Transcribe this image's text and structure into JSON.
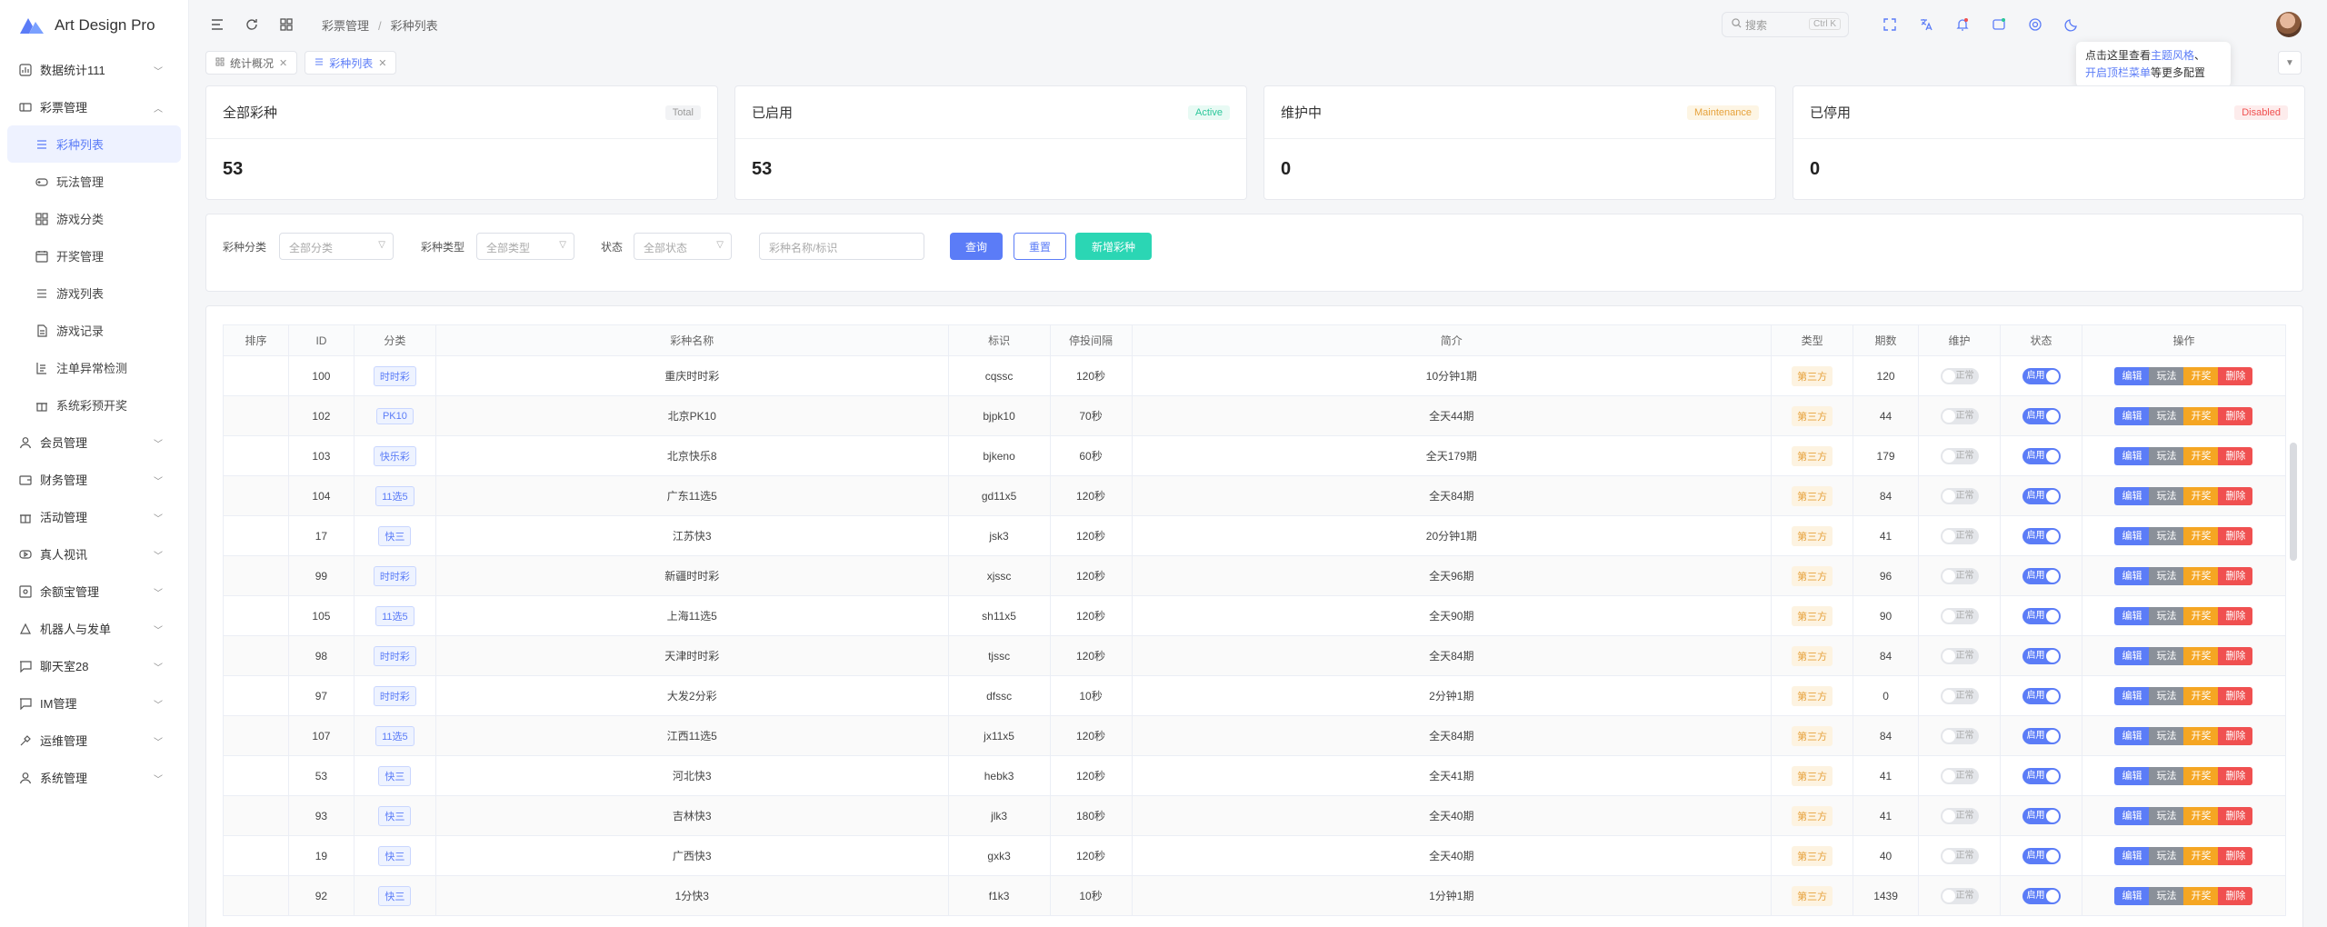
{
  "app": {
    "name": "Art Design Pro",
    "brand_color": "#5b7cf7"
  },
  "sidebar": {
    "items": [
      {
        "label": "数据统计111",
        "icon": "chart-icon",
        "expanded": false
      },
      {
        "label": "彩票管理",
        "icon": "ticket-icon",
        "expanded": true
      },
      {
        "label": "会员管理",
        "icon": "user-icon",
        "expanded": false
      },
      {
        "label": "财务管理",
        "icon": "wallet-icon",
        "expanded": false
      },
      {
        "label": "活动管理",
        "icon": "gift-icon",
        "expanded": false
      },
      {
        "label": "真人视讯",
        "icon": "video-icon",
        "expanded": false
      },
      {
        "label": "余额宝管理",
        "icon": "safe-icon",
        "expanded": false
      },
      {
        "label": "机器人与发单",
        "icon": "robot-icon",
        "expanded": false
      },
      {
        "label": "聊天室28",
        "icon": "chat-icon",
        "expanded": false
      },
      {
        "label": "IM管理",
        "icon": "message-icon",
        "expanded": false
      },
      {
        "label": "运维管理",
        "icon": "tools-icon",
        "expanded": false
      },
      {
        "label": "系统管理",
        "icon": "user-icon",
        "expanded": false
      }
    ],
    "subitems": [
      {
        "label": "彩种列表",
        "icon": "list-icon",
        "active": true
      },
      {
        "label": "玩法管理",
        "icon": "gamepad-icon",
        "active": false
      },
      {
        "label": "游戏分类",
        "icon": "grid-icon",
        "active": false
      },
      {
        "label": "开奖管理",
        "icon": "calendar-icon",
        "active": false
      },
      {
        "label": "游戏列表",
        "icon": "list-icon",
        "active": false
      },
      {
        "label": "游戏记录",
        "icon": "document-icon",
        "active": false
      },
      {
        "label": "注单异常检测",
        "icon": "scan-icon",
        "active": false
      },
      {
        "label": "系统彩预开奖",
        "icon": "gift-icon",
        "active": false
      }
    ]
  },
  "topbar": {
    "breadcrumb": [
      "彩票管理",
      "彩种列表"
    ],
    "search_placeholder": "搜索",
    "search_shortcut": "Ctrl K"
  },
  "tabs": [
    {
      "label": "统计概况",
      "active": false
    },
    {
      "label": "彩种列表",
      "active": true
    }
  ],
  "tooltip": {
    "prefix": "点击这里查看",
    "link1": "主题风格",
    "sep": "、",
    "link2": "开启顶栏菜单",
    "suffix": "等更多配置"
  },
  "stats": [
    {
      "title": "全部彩种",
      "tag": "Total",
      "value": "53",
      "tag_bg": "#f2f3f5",
      "tag_color": "#999999"
    },
    {
      "title": "已启用",
      "tag": "Active",
      "value": "53",
      "tag_bg": "#e8faf4",
      "tag_color": "#2bc79a"
    },
    {
      "title": "维护中",
      "tag": "Maintenance",
      "value": "0",
      "tag_bg": "#fdf5e4",
      "tag_color": "#e6a23c"
    },
    {
      "title": "已停用",
      "tag": "Disabled",
      "value": "0",
      "tag_bg": "#fdecec",
      "tag_color": "#f05050"
    }
  ],
  "filter": {
    "category_label": "彩种分类",
    "category_placeholder": "全部分类",
    "type_label": "彩种类型",
    "type_placeholder": "全部类型",
    "status_label": "状态",
    "status_placeholder": "全部状态",
    "keyword_placeholder": "彩种名称/标识",
    "search_btn": "查询",
    "reset_btn": "重置",
    "add_btn": "新增彩种"
  },
  "table": {
    "headers": [
      "排序",
      "ID",
      "分类",
      "彩种名称",
      "标识",
      "停投间隔",
      "简介",
      "类型",
      "期数",
      "维护",
      "状态",
      "操作"
    ],
    "maintenance_label": "正常",
    "status_label": "启用",
    "actions": [
      "编辑",
      "玩法",
      "开奖",
      "删除"
    ],
    "rows": [
      {
        "id": "100",
        "cat": "时时彩",
        "name": "重庆时时彩",
        "code": "cqssc",
        "interval": "120秒",
        "desc": "10分钟1期",
        "type": "第三方",
        "issues": "120"
      },
      {
        "id": "102",
        "cat": "PK10",
        "name": "北京PK10",
        "code": "bjpk10",
        "interval": "70秒",
        "desc": "全天44期",
        "type": "第三方",
        "issues": "44"
      },
      {
        "id": "103",
        "cat": "快乐彩",
        "name": "北京快乐8",
        "code": "bjkeno",
        "interval": "60秒",
        "desc": "全天179期",
        "type": "第三方",
        "issues": "179"
      },
      {
        "id": "104",
        "cat": "11选5",
        "name": "广东11选5",
        "code": "gd11x5",
        "interval": "120秒",
        "desc": "全天84期",
        "type": "第三方",
        "issues": "84"
      },
      {
        "id": "17",
        "cat": "快三",
        "name": "江苏快3",
        "code": "jsk3",
        "interval": "120秒",
        "desc": "20分钟1期",
        "type": "第三方",
        "issues": "41"
      },
      {
        "id": "99",
        "cat": "时时彩",
        "name": "新疆时时彩",
        "code": "xjssc",
        "interval": "120秒",
        "desc": "全天96期",
        "type": "第三方",
        "issues": "96"
      },
      {
        "id": "105",
        "cat": "11选5",
        "name": "上海11选5",
        "code": "sh11x5",
        "interval": "120秒",
        "desc": "全天90期",
        "type": "第三方",
        "issues": "90"
      },
      {
        "id": "98",
        "cat": "时时彩",
        "name": "天津时时彩",
        "code": "tjssc",
        "interval": "120秒",
        "desc": "全天84期",
        "type": "第三方",
        "issues": "84"
      },
      {
        "id": "97",
        "cat": "时时彩",
        "name": "大发2分彩",
        "code": "dfssc",
        "interval": "10秒",
        "desc": "2分钟1期",
        "type": "第三方",
        "issues": "0"
      },
      {
        "id": "107",
        "cat": "11选5",
        "name": "江西11选5",
        "code": "jx11x5",
        "interval": "120秒",
        "desc": "全天84期",
        "type": "第三方",
        "issues": "84"
      },
      {
        "id": "53",
        "cat": "快三",
        "name": "河北快3",
        "code": "hebk3",
        "interval": "120秒",
        "desc": "全天41期",
        "type": "第三方",
        "issues": "41"
      },
      {
        "id": "93",
        "cat": "快三",
        "name": "吉林快3",
        "code": "jlk3",
        "interval": "180秒",
        "desc": "全天40期",
        "type": "第三方",
        "issues": "41"
      },
      {
        "id": "19",
        "cat": "快三",
        "name": "广西快3",
        "code": "gxk3",
        "interval": "120秒",
        "desc": "全天40期",
        "type": "第三方",
        "issues": "40"
      },
      {
        "id": "92",
        "cat": "快三",
        "name": "1分快3",
        "code": "f1k3",
        "interval": "10秒",
        "desc": "1分钟1期",
        "type": "第三方",
        "issues": "1439"
      }
    ]
  }
}
